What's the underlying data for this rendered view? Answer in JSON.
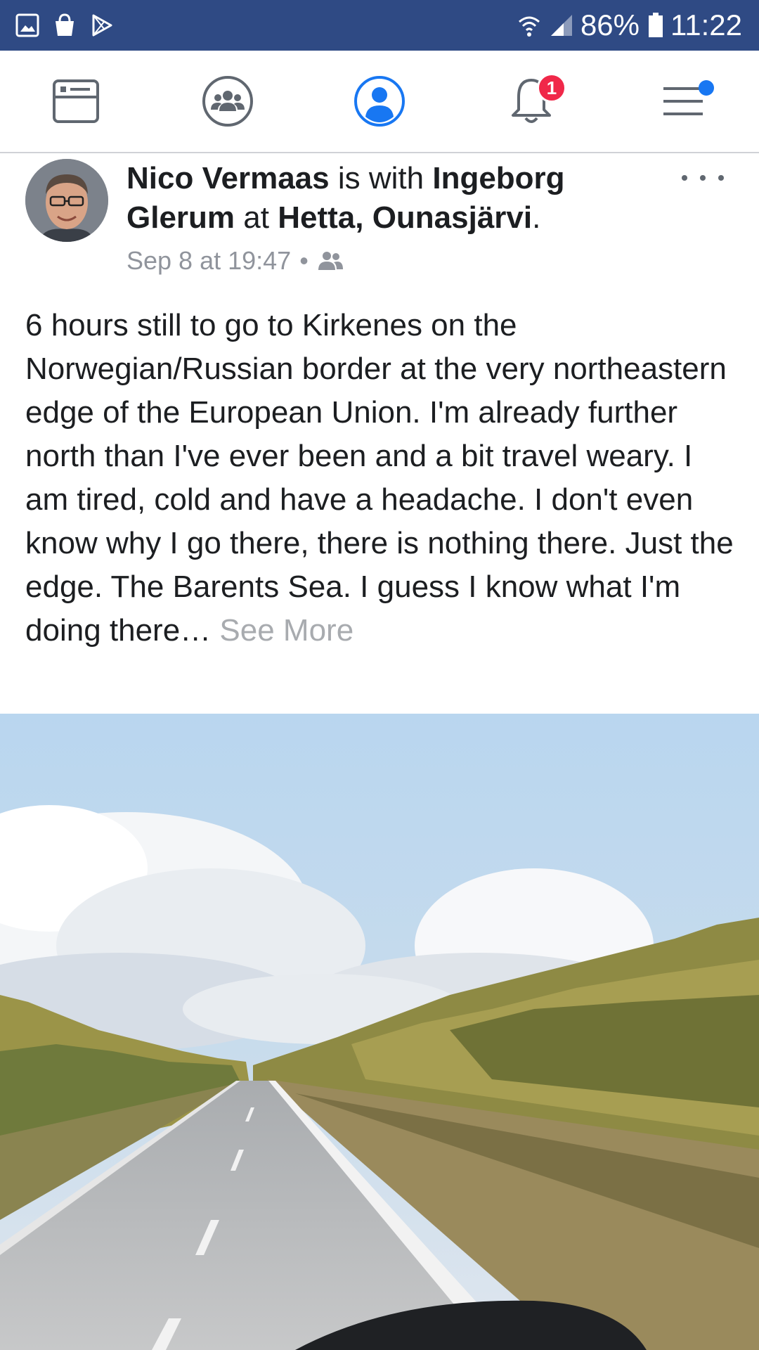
{
  "status_bar": {
    "icons_left": [
      "gallery-icon",
      "shopping-bag-icon",
      "play-store-icon"
    ],
    "battery_percent": "86%",
    "time": "11:22",
    "icons_right": [
      "wifi-icon",
      "signal-icon",
      "battery-icon"
    ]
  },
  "nav": {
    "items": [
      "news-feed-icon",
      "groups-icon",
      "profile-icon",
      "notifications-icon",
      "menu-icon"
    ],
    "active": "profile-icon",
    "notification_count": "1",
    "accent_color": "#1877f2",
    "badge_color": "#f02849"
  },
  "post": {
    "author": "Nico Vermaas",
    "with_text": "is with",
    "tagged": "Ingeborg Glerum",
    "at_text": "at",
    "location": "Hetta, Ounasjärvi",
    "period": ".",
    "timestamp": "Sep 8 at 19:47",
    "separator": "•",
    "audience_icon": "friends-icon",
    "body": "6 hours still to go to Kirkenes on the Norwegian/Russian border at the very northeastern edge of the European Union. I'm already further north than I've ever been and a bit travel weary. I am tired, cold and have a headache. I don't even know why I go there, there is nothing there. Just the edge. The Barents Sea. I guess I know what I'm doing there…",
    "see_more": "See More"
  },
  "colors": {
    "status_bar": "#2f4a84",
    "text": "#1c1e21",
    "meta": "#90949c"
  }
}
